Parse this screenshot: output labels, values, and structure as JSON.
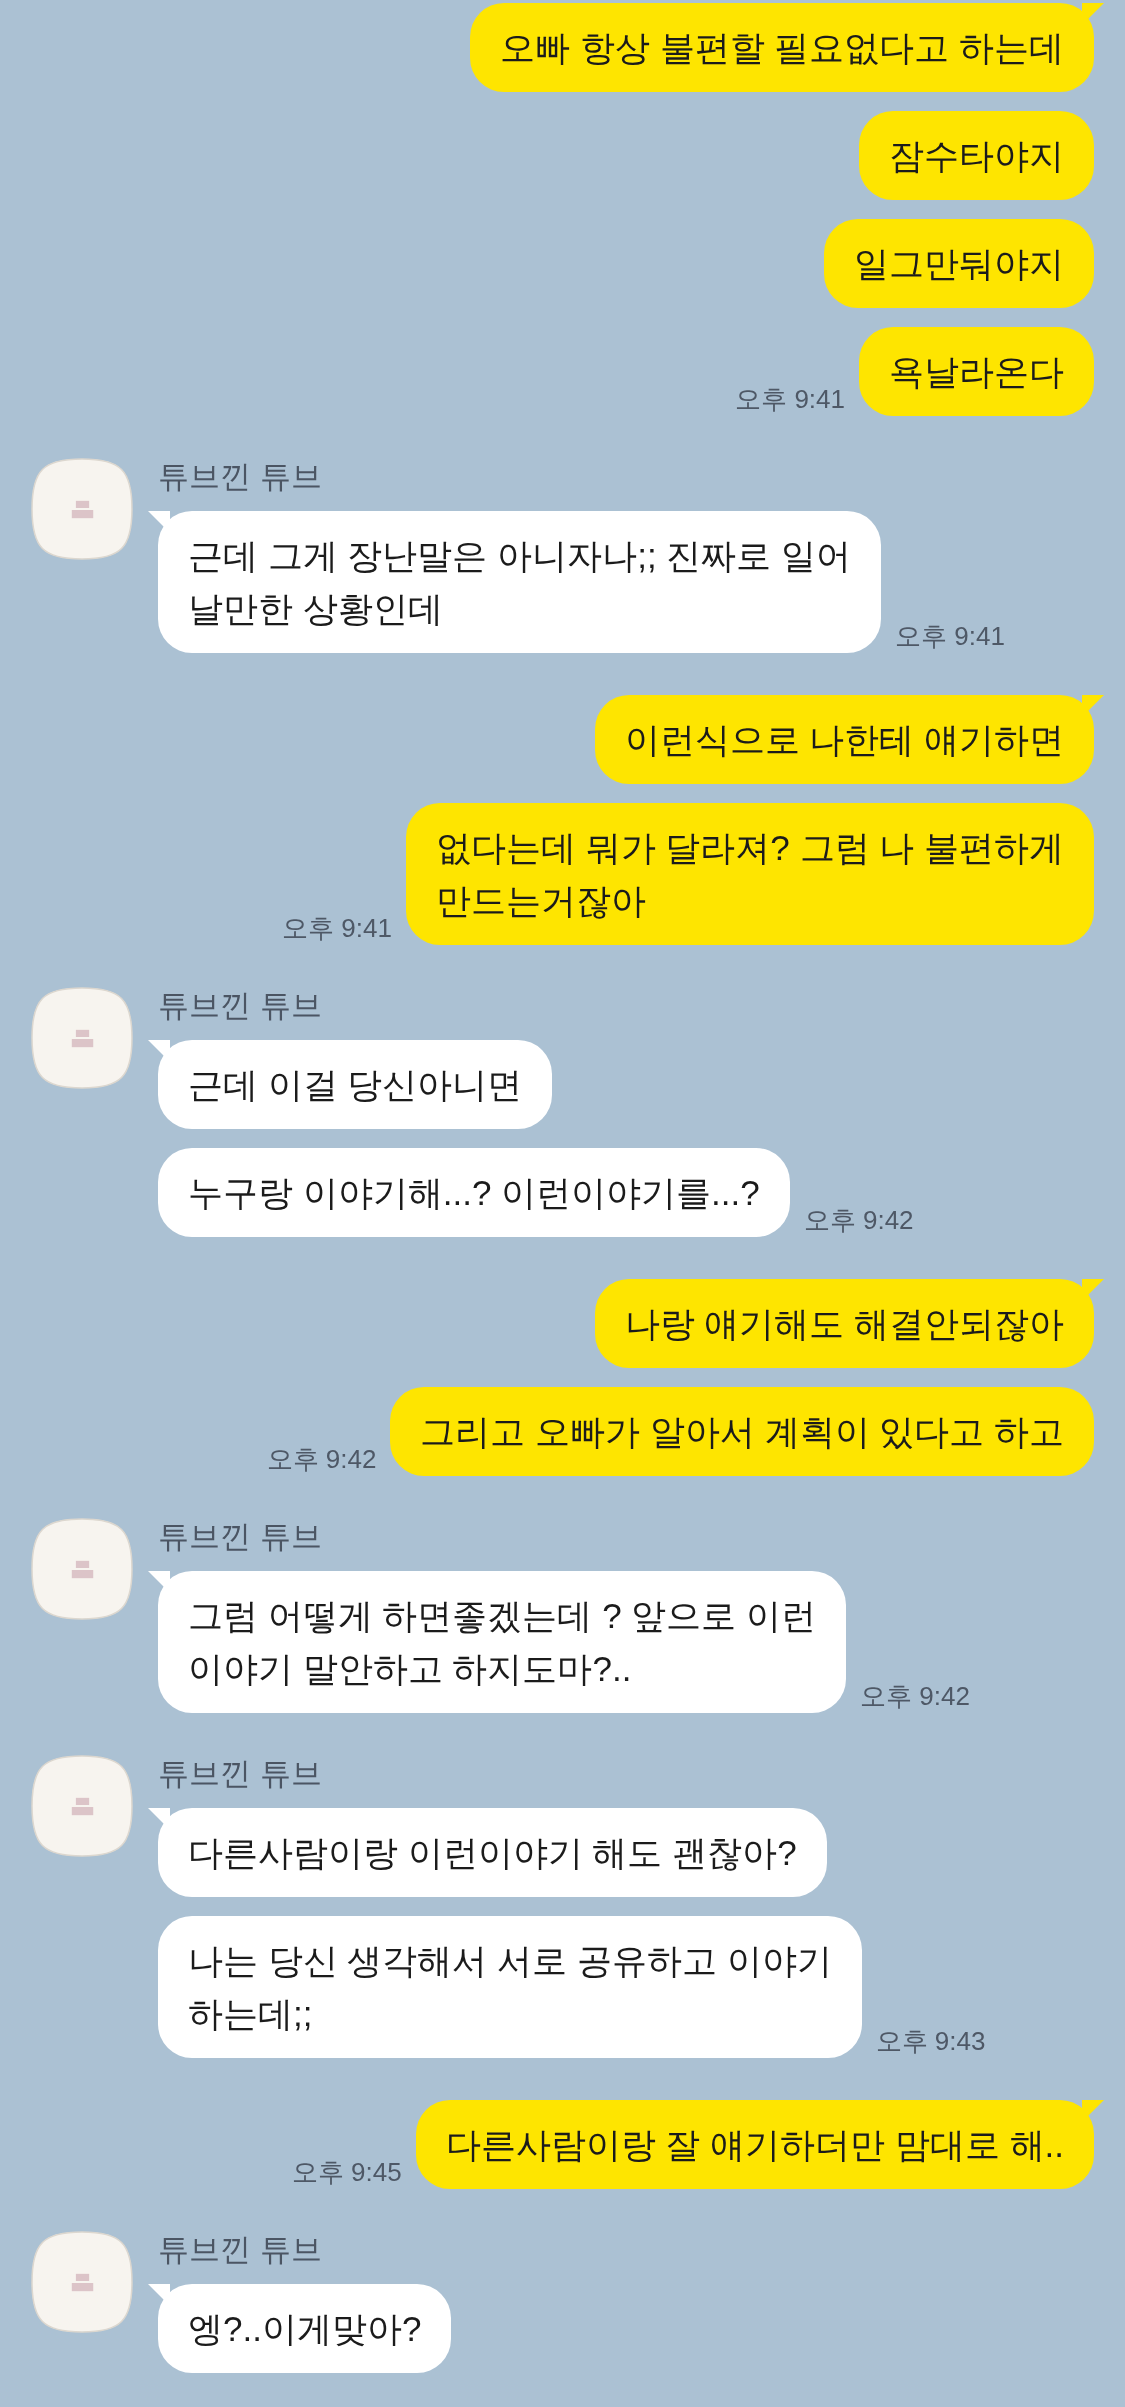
{
  "messages": [
    {
      "kind": "me",
      "bubbles": [
        {
          "text": "오빠 항상 불편할 필요없다고 하는데"
        },
        {
          "text": "잠수타야지"
        },
        {
          "text": "일그만둬야지"
        },
        {
          "text": "욕날라온다",
          "time": "오후 9:41"
        }
      ]
    },
    {
      "kind": "other",
      "name": "튜브낀 튜브",
      "bubbles": [
        {
          "text": "근데 그게 장난말은 아니자나;; 진짜로 일어\n날만한 상황인데",
          "time": "오후 9:41"
        }
      ]
    },
    {
      "kind": "me",
      "bubbles": [
        {
          "text": "이런식으로 나한테 얘기하면"
        },
        {
          "text": "없다는데 뭐가 달라져? 그럼 나 불편하게\n만드는거잖아",
          "time": "오후 9:41"
        }
      ]
    },
    {
      "kind": "other",
      "name": "튜브낀 튜브",
      "bubbles": [
        {
          "text": "근데 이걸 당신아니면"
        },
        {
          "text": "누구랑 이야기해...? 이런이야기를...?",
          "time": "오후 9:42"
        }
      ]
    },
    {
      "kind": "me",
      "bubbles": [
        {
          "text": "나랑 얘기해도 해결안되잖아"
        },
        {
          "text": "그리고 오빠가 알아서 계획이 있다고 하고",
          "time": "오후 9:42"
        }
      ]
    },
    {
      "kind": "other",
      "name": "튜브낀 튜브",
      "bubbles": [
        {
          "text": "그럼 어떻게 하면좋겠는데 ? 앞으로 이런\n이야기 말안하고 하지도마?..",
          "time": "오후 9:42"
        }
      ]
    },
    {
      "kind": "other",
      "name": "튜브낀 튜브",
      "bubbles": [
        {
          "text": "다른사람이랑 이런이야기 해도 괜찮아?"
        },
        {
          "text": "나는 당신 생각해서 서로 공유하고 이야기\n하는데;;",
          "time": "오후 9:43"
        }
      ]
    },
    {
      "kind": "me",
      "bubbles": [
        {
          "text": "다른사람이랑 잘 얘기하더만 맘대로 해..",
          "time": "오후 9:45"
        }
      ]
    },
    {
      "kind": "other",
      "name": "튜브낀 튜브",
      "bubbles": [
        {
          "text": "엥?..이게맞아?"
        }
      ]
    }
  ]
}
